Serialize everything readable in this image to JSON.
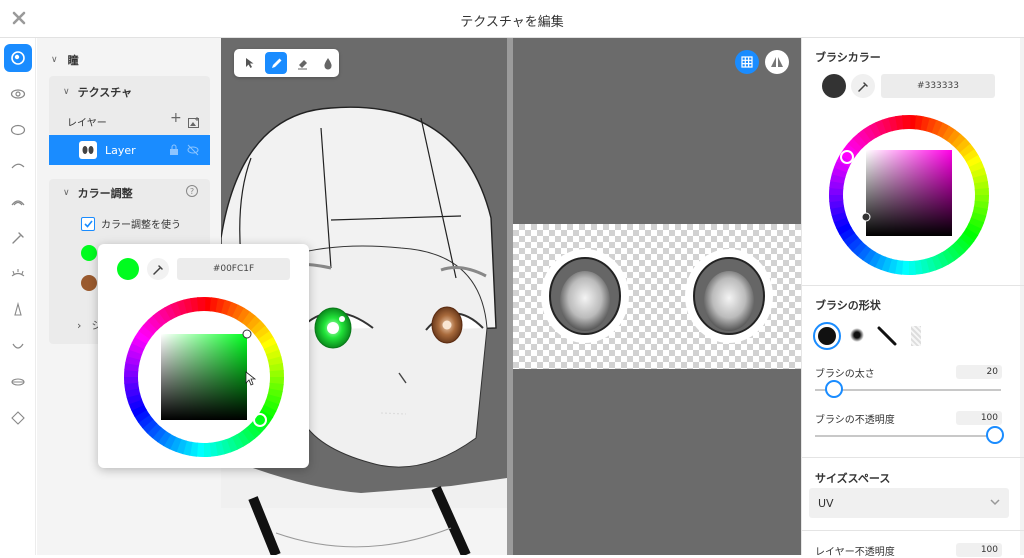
{
  "header": {
    "title": "テクスチャを編集",
    "close_glyph": "✕"
  },
  "toolstrip": {
    "items": [
      {
        "icon": "eye-part-icon",
        "active": true
      },
      {
        "icon": "eye-outline-icon"
      },
      {
        "icon": "oval-icon"
      },
      {
        "icon": "brow-icon"
      },
      {
        "icon": "ear-icon"
      },
      {
        "icon": "eyedropper-icon"
      },
      {
        "icon": "lash-icon"
      },
      {
        "icon": "nose-icon"
      },
      {
        "icon": "mouth-icon"
      },
      {
        "icon": "lip-icon"
      },
      {
        "icon": "face-shape-icon"
      }
    ]
  },
  "left_panel": {
    "section_title": "瞳",
    "texture_title": "テクスチャ",
    "layer_label": "レイヤー",
    "layer_name": "Layer",
    "color_adjust_title": "カラー調整",
    "use_color_adjust_label": "カラー調整を使う",
    "use_color_adjust_checked": true,
    "swatches": [
      "#00FC1F",
      "#9A5A2E"
    ],
    "collapsed_row_label": "シ"
  },
  "color_popover": {
    "swatch_color": "#00FC1F",
    "hex_value": "#00FC1F"
  },
  "viewport_toolbar": {
    "tools": [
      "select-arrow-icon",
      "pen-icon",
      "eraser-icon",
      "fill-drop-icon"
    ],
    "active_tool": "pen-icon"
  },
  "view2d_buttons": [
    "grid-toggle-icon",
    "mirror-icon"
  ],
  "right_panel": {
    "brush_color_title": "ブラシカラー",
    "brush_color_hex": "#333333",
    "brush_color": "#333333",
    "brush_shape_title": "ブラシの形状",
    "brush_size_label": "ブラシの太さ",
    "brush_size_value": "20",
    "brush_size_fraction": 0.1,
    "brush_opacity_label": "ブラシの不透明度",
    "brush_opacity_value": "100",
    "brush_opacity_fraction": 1.0,
    "size_space_title": "サイズスペース",
    "size_space_value": "UV",
    "layer_opacity_label": "レイヤー不透明度",
    "layer_opacity_value": "100"
  },
  "colors": {
    "accent": "#1a8cff",
    "viewport_bg": "#6b6b6b",
    "panel_bg": "#f4f4f4"
  }
}
